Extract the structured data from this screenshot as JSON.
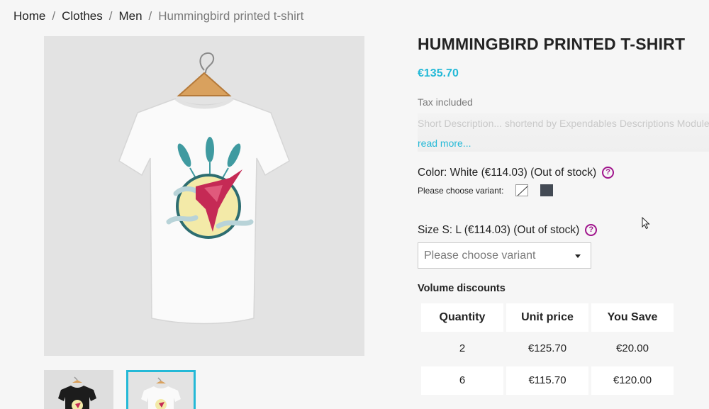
{
  "breadcrumb": {
    "items": [
      "Home",
      "Clothes",
      "Men"
    ],
    "separator": "/",
    "current": "Hummingbird printed t-shirt"
  },
  "product": {
    "title": "HUMMINGBIRD PRINTED T-SHIRT",
    "price": "€135.70",
    "tax_label": "Tax included",
    "short_description": "Short Description... shortend by Expendables Descriptions Module",
    "read_more": "read more..."
  },
  "color": {
    "label": "Color: White (€114.03) (Out of stock)",
    "help": "?",
    "choose_label": "Please choose variant:",
    "swatches": [
      {
        "name": "White",
        "hex": "#ffffff"
      },
      {
        "name": "Dark grey",
        "hex": "#434a54"
      }
    ]
  },
  "size": {
    "label": "Size S: L (€114.03) (Out of stock)",
    "help": "?",
    "select_value": "Please choose variant"
  },
  "volume_discounts": {
    "title": "Volume discounts",
    "headers": [
      "Quantity",
      "Unit price",
      "You Save"
    ],
    "rows": [
      [
        "2",
        "€125.70",
        "€20.00"
      ],
      [
        "6",
        "€115.70",
        "€120.00"
      ]
    ]
  },
  "colors": {
    "accent": "#24b9d7",
    "help": "#a0148c",
    "text": "#232323",
    "muted": "#7a7a7a"
  }
}
